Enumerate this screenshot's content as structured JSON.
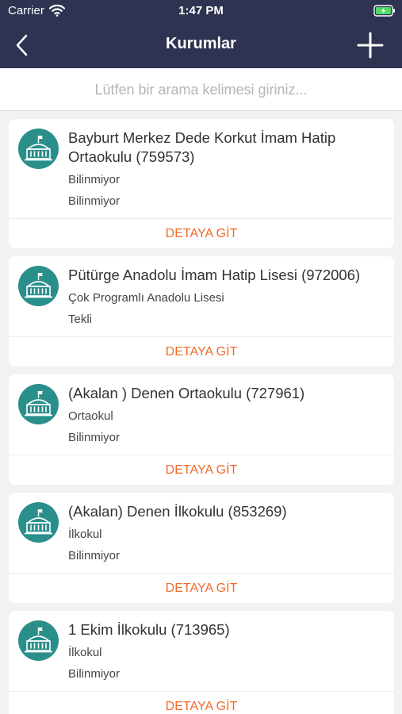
{
  "status_bar": {
    "carrier": "Carrier",
    "time": "1:47 PM"
  },
  "nav": {
    "title": "Kurumlar"
  },
  "search": {
    "placeholder": "Lütfen bir arama kelimesi giriniz..."
  },
  "institutions": [
    {
      "title": " Bayburt Merkez Dede Korkut İmam Hatip Ortaokulu (759573)",
      "line1": "Bilinmiyor",
      "line2": "Bilinmiyor",
      "action": "DETAYA GİT"
    },
    {
      "title": " Pütürge Anadolu İmam Hatip Lisesi (972006)",
      "line1": "Çok Programlı Anadolu Lisesi",
      "line2": "Tekli",
      "action": "DETAYA GİT"
    },
    {
      "title": "(Akalan ) Denen Ortaokulu (727961)",
      "line1": "Ortaokul",
      "line2": "Bilinmiyor",
      "action": "DETAYA GİT"
    },
    {
      "title": "(Akalan) Denen İlkokulu (853269)",
      "line1": "İlkokul",
      "line2": "Bilinmiyor",
      "action": "DETAYA GİT"
    },
    {
      "title": "1 Ekim İlkokulu (713965)",
      "line1": "İlkokul",
      "line2": "Bilinmiyor",
      "action": "DETAYA GİT"
    }
  ],
  "colors": {
    "navbar": "#2d3350",
    "icon_bg": "#2a8f8b",
    "action": "#f06b2c"
  },
  "icons": {
    "back": "chevron-left-icon",
    "add": "plus-icon",
    "institution": "school-building-icon"
  }
}
